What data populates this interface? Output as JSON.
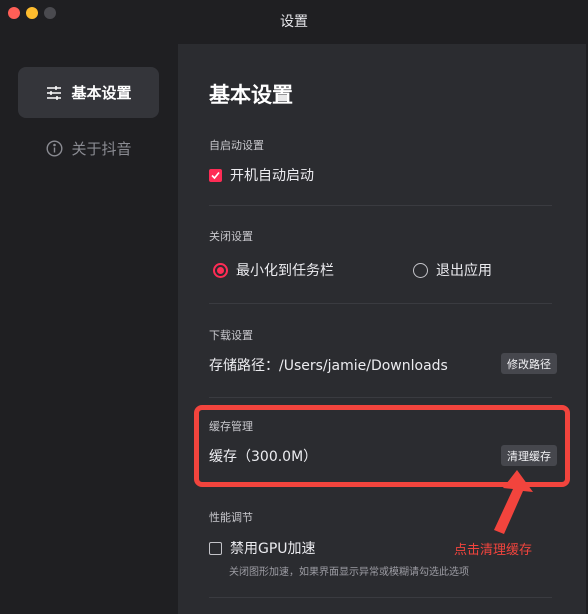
{
  "window": {
    "title": "设置"
  },
  "sidebar": {
    "items": [
      {
        "label": "基本设置",
        "icon": "sliders-icon",
        "active": true
      },
      {
        "label": "关于抖音",
        "icon": "info-icon",
        "active": false
      }
    ]
  },
  "main": {
    "title": "基本设置",
    "autostart": {
      "label": "自启动设置",
      "option_label": "开机自动启动",
      "checked": true
    },
    "close": {
      "label": "关闭设置",
      "options": [
        {
          "label": "最小化到任务栏",
          "selected": true
        },
        {
          "label": "退出应用",
          "selected": false
        }
      ]
    },
    "download": {
      "label": "下载设置",
      "path_text": "存储路径：/Users/jamie/Downloads",
      "button_label": "修改路径"
    },
    "cache": {
      "label": "缓存管理",
      "value_text": "缓存（300.0M）",
      "button_label": "清理缓存"
    },
    "performance": {
      "label": "性能调节",
      "option_label": "禁用GPU加速",
      "checked": false,
      "note": "关闭图形加速，如果界面显示异常或模糊请勾选此选项"
    }
  },
  "annotation": {
    "text": "点击清理缓存"
  },
  "colors": {
    "accent": "#fe2c55",
    "annotation": "#f2443d",
    "sidebar_bg": "#1f1f22",
    "main_bg": "#2b2c30"
  }
}
